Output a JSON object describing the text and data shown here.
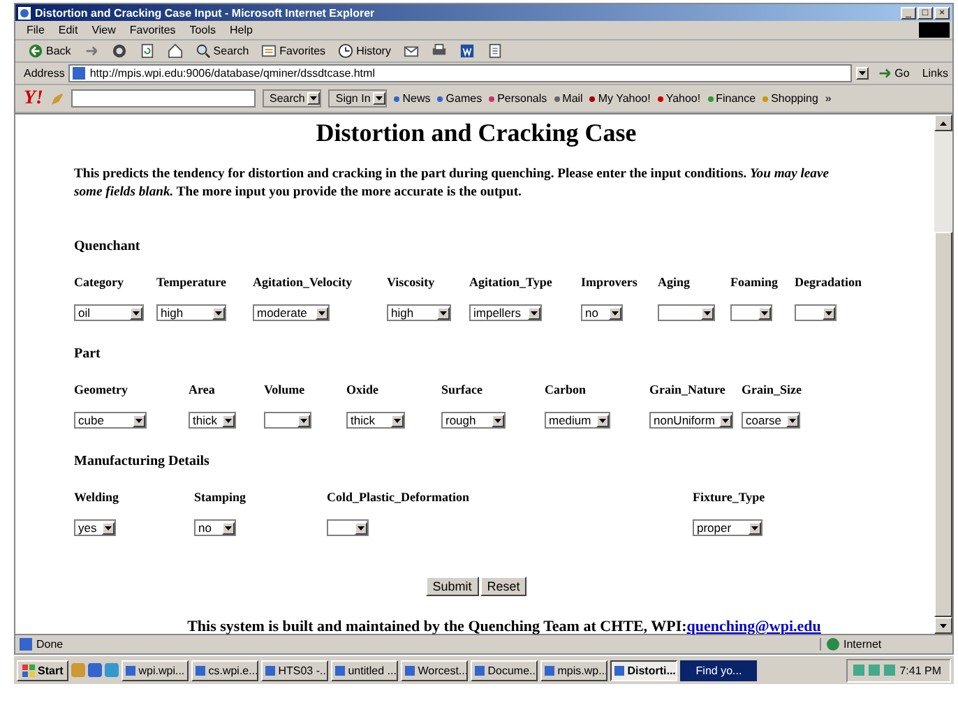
{
  "window": {
    "title": "Distortion and Cracking Case Input - Microsoft Internet Explorer",
    "controls": [
      "_",
      "□",
      "×"
    ]
  },
  "menu": [
    "File",
    "Edit",
    "View",
    "Favorites",
    "Tools",
    "Help"
  ],
  "toolbar": [
    {
      "label": "Back",
      "kind": "back"
    },
    {
      "kind": "forward"
    },
    {
      "kind": "stop"
    },
    {
      "kind": "refresh"
    },
    {
      "kind": "home"
    },
    {
      "label": "Search",
      "kind": "search"
    },
    {
      "label": "Favorites",
      "kind": "favorites"
    },
    {
      "label": "History",
      "kind": "history"
    },
    {
      "kind": "mail"
    },
    {
      "kind": "print"
    },
    {
      "kind": "edit"
    },
    {
      "kind": "discuss"
    }
  ],
  "address": {
    "label": "Address",
    "value": "http://mpis.wpi.edu:9006/database/qminer/dssdtcase.html",
    "go": "Go",
    "links": "Links"
  },
  "yahoo_bar": {
    "logo": "Y!",
    "search_button": "Search",
    "sign_in": "Sign In",
    "items": [
      "News",
      "Games",
      "Personals",
      "Mail",
      "My Yahoo!",
      "Yahoo!",
      "Finance",
      "Shopping"
    ],
    "more": "»"
  },
  "page": {
    "heading": "Distortion and Cracking Case",
    "intro": "This predicts the tendency for distortion and cracking in the part during quenching. Please enter the input conditions. *You may leave some fields blank.* The more input you provide the more accurate is the output.",
    "sections": [
      {
        "title": "Quenchant",
        "fields": [
          {
            "label": "Category",
            "value": "oil"
          },
          {
            "label": "Temperature",
            "value": "high"
          },
          {
            "label": "Agitation_Velocity",
            "value": "moderate"
          },
          {
            "label": "Viscosity",
            "value": "high"
          },
          {
            "label": "Agitation_Type",
            "value": "impellers"
          },
          {
            "label": "Improvers",
            "value": "no"
          },
          {
            "label": "Aging"
          },
          {
            "label": "Foaming"
          },
          {
            "label": "Degradation"
          }
        ]
      },
      {
        "title": "Part",
        "fields": [
          {
            "label": "Geometry",
            "value": "cube"
          },
          {
            "label": "Area",
            "value": "thick"
          },
          {
            "label": "Volume"
          },
          {
            "label": "Oxide",
            "value": "thick"
          },
          {
            "label": "Surface",
            "value": "rough"
          },
          {
            "label": "Carbon",
            "value": "medium"
          },
          {
            "label": "Grain_Nature",
            "value": "nonUniform"
          },
          {
            "label": "Grain_Size",
            "value": "coarse"
          }
        ]
      },
      {
        "title": "Manufacturing Details",
        "fields": [
          {
            "label": "Welding",
            "value": "yes"
          },
          {
            "label": "Stamping",
            "value": "no"
          },
          {
            "label": "Cold_Plastic_Deformation"
          },
          {
            "label": "Fixture_Type",
            "value": "proper"
          }
        ]
      }
    ],
    "buttons": [
      "Submit",
      "Reset"
    ],
    "footer": "This system is built and maintained by the Quenching Team at CHTE, WPI:",
    "footer_link": "quenching@wpi.edu"
  },
  "status_bar": {
    "text": "Done",
    "zone": "Internet"
  },
  "taskbar": {
    "start": "Start",
    "tasks": [
      {
        "label": "wpi.wpi...",
        "selected": false
      },
      {
        "label": "cs.wpi.e...",
        "selected": false
      },
      {
        "label": "HTS03 -...",
        "selected": false
      },
      {
        "label": "untitled ...",
        "selected": false
      },
      {
        "label": "Worcest...",
        "selected": false
      },
      {
        "label": "Docume...",
        "selected": false
      },
      {
        "label": "mpis.wp...",
        "selected": false
      },
      {
        "label": "Distorti...",
        "selected": true
      }
    ],
    "find": "Find yo...",
    "clock": "7:41 PM"
  }
}
